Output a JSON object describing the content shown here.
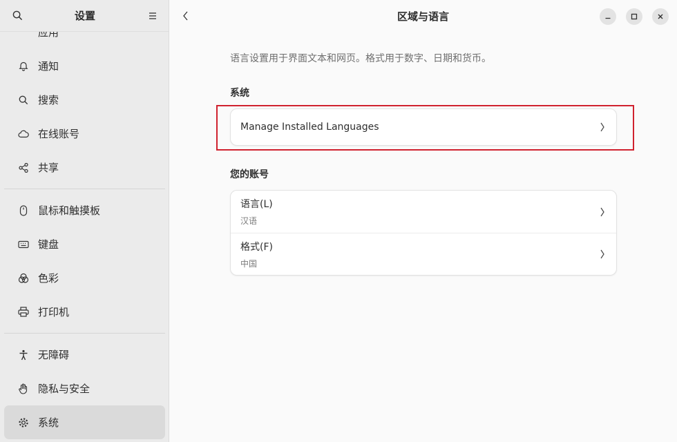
{
  "sidebar": {
    "title": "设置",
    "items": [
      {
        "label": "应用",
        "icon": "apps-icon"
      },
      {
        "label": "通知",
        "icon": "bell-icon"
      },
      {
        "label": "搜索",
        "icon": "search-icon"
      },
      {
        "label": "在线账号",
        "icon": "cloud-icon"
      },
      {
        "label": "共享",
        "icon": "share-icon"
      },
      {
        "label": "鼠标和触摸板",
        "icon": "mouse-icon"
      },
      {
        "label": "键盘",
        "icon": "keyboard-icon"
      },
      {
        "label": "色彩",
        "icon": "color-icon"
      },
      {
        "label": "打印机",
        "icon": "printer-icon"
      },
      {
        "label": "无障碍",
        "icon": "accessibility-icon"
      },
      {
        "label": "隐私与安全",
        "icon": "hand-icon"
      },
      {
        "label": "系统",
        "icon": "gear-icon",
        "active": true
      }
    ]
  },
  "main": {
    "title": "区域与语言",
    "description": "语言设置用于界面文本和网页。格式用于数字、日期和货币。",
    "system_section": {
      "title": "系统",
      "rows": [
        {
          "label": "Manage Installed Languages"
        }
      ]
    },
    "account_section": {
      "title": "您的账号",
      "rows": [
        {
          "label": "语言(L)",
          "value": "汉语"
        },
        {
          "label": "格式(F)",
          "value": "中国"
        }
      ]
    }
  },
  "colors": {
    "highlight": "#d0212e",
    "sidebar_bg": "#ebebeb",
    "main_bg": "#fafafa"
  }
}
